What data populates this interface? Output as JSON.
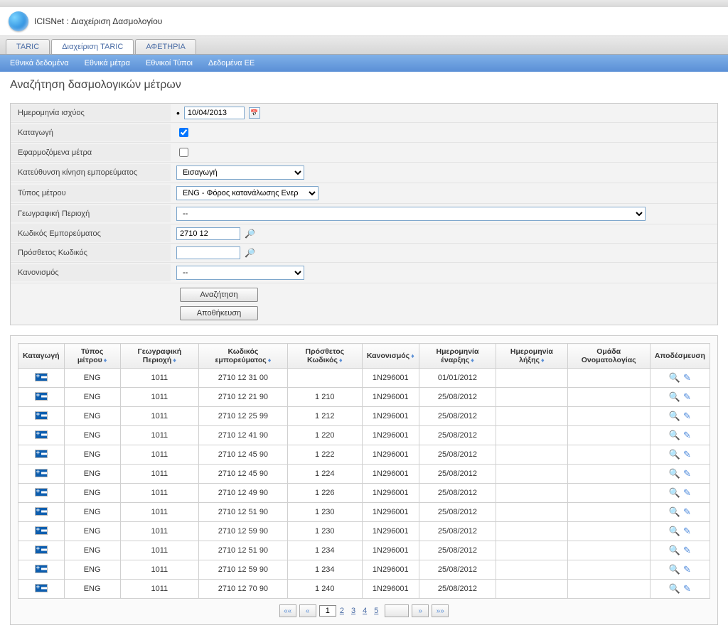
{
  "app": {
    "title": "ICISNet : Διαχείριση Δασμολογίου"
  },
  "tabs": [
    {
      "label": "TARIC",
      "active": false
    },
    {
      "label": "Διαχείριση TARIC",
      "active": true
    },
    {
      "label": "ΑΦΕΤΗΡΙΑ",
      "active": false
    }
  ],
  "subtabs": [
    {
      "label": "Εθνικά δεδομένα"
    },
    {
      "label": "Εθνικά μέτρα"
    },
    {
      "label": "Εθνικοί Τύποι"
    },
    {
      "label": "Δεδομένα ΕΕ"
    }
  ],
  "page": {
    "title": "Αναζήτηση δασμολογικών μέτρων"
  },
  "form": {
    "effective_date_label": "Ημερομηνία ισχύος",
    "effective_date_value": "10/04/2013",
    "origin_label": "Καταγωγή",
    "origin_checked": true,
    "applied_measures_label": "Εφαρμοζόμενα μέτρα",
    "applied_measures_checked": false,
    "direction_label": "Κατεύθυνση κίνηση εμπορεύματος",
    "direction_value": "Εισαγωγή",
    "measure_type_label": "Τύπος μέτρου",
    "measure_type_value": "ENG - Φόρος κατανάλωσης Ενερ",
    "geo_label": "Γεωγραφική Περιοχή",
    "geo_value": "--",
    "commodity_code_label": "Κωδικός Εμπορεύματος",
    "commodity_code_value": "2710 12",
    "addl_code_label": "Πρόσθετος Κωδικός",
    "addl_code_value": "",
    "regulation_label": "Κανονισμός",
    "regulation_value": "--",
    "search_btn": "Αναζήτηση",
    "save_btn": "Αποθήκευση"
  },
  "columns": {
    "origin": "Καταγωγή",
    "measure_type": "Τύπος μέτρου",
    "geo": "Γεωγραφική Περιοχή",
    "commodity": "Κωδικός εμπορεύματος",
    "addl": "Πρόσθετος Κωδικός",
    "regulation": "Κανονισμός",
    "start": "Ημερομηνία έναρξης",
    "end": "Ημερομηνία λήξης",
    "nomgroup": "Ομάδα Ονοματολογίας",
    "release": "Αποδέσμευση"
  },
  "rows": [
    {
      "type": "ENG",
      "geo": "1011",
      "commodity": "2710 12 31 00",
      "addl": "",
      "reg": "1N296001",
      "start": "01/01/2012",
      "end": ""
    },
    {
      "type": "ENG",
      "geo": "1011",
      "commodity": "2710 12 21 90",
      "addl": "1 210",
      "reg": "1N296001",
      "start": "25/08/2012",
      "end": ""
    },
    {
      "type": "ENG",
      "geo": "1011",
      "commodity": "2710 12 25 99",
      "addl": "1 212",
      "reg": "1N296001",
      "start": "25/08/2012",
      "end": ""
    },
    {
      "type": "ENG",
      "geo": "1011",
      "commodity": "2710 12 41 90",
      "addl": "1 220",
      "reg": "1N296001",
      "start": "25/08/2012",
      "end": ""
    },
    {
      "type": "ENG",
      "geo": "1011",
      "commodity": "2710 12 45 90",
      "addl": "1 222",
      "reg": "1N296001",
      "start": "25/08/2012",
      "end": ""
    },
    {
      "type": "ENG",
      "geo": "1011",
      "commodity": "2710 12 45 90",
      "addl": "1 224",
      "reg": "1N296001",
      "start": "25/08/2012",
      "end": ""
    },
    {
      "type": "ENG",
      "geo": "1011",
      "commodity": "2710 12 49 90",
      "addl": "1 226",
      "reg": "1N296001",
      "start": "25/08/2012",
      "end": ""
    },
    {
      "type": "ENG",
      "geo": "1011",
      "commodity": "2710 12 51 90",
      "addl": "1 230",
      "reg": "1N296001",
      "start": "25/08/2012",
      "end": ""
    },
    {
      "type": "ENG",
      "geo": "1011",
      "commodity": "2710 12 59 90",
      "addl": "1 230",
      "reg": "1N296001",
      "start": "25/08/2012",
      "end": ""
    },
    {
      "type": "ENG",
      "geo": "1011",
      "commodity": "2710 12 51 90",
      "addl": "1 234",
      "reg": "1N296001",
      "start": "25/08/2012",
      "end": ""
    },
    {
      "type": "ENG",
      "geo": "1011",
      "commodity": "2710 12 59 90",
      "addl": "1 234",
      "reg": "1N296001",
      "start": "25/08/2012",
      "end": ""
    },
    {
      "type": "ENG",
      "geo": "1011",
      "commodity": "2710 12 70 90",
      "addl": "1 240",
      "reg": "1N296001",
      "start": "25/08/2012",
      "end": ""
    }
  ],
  "pagination": {
    "first": "««",
    "prev": "«",
    "pages": [
      "1",
      "2",
      "3",
      "4",
      "5"
    ],
    "current": "1",
    "next": "»",
    "last": "»»"
  }
}
